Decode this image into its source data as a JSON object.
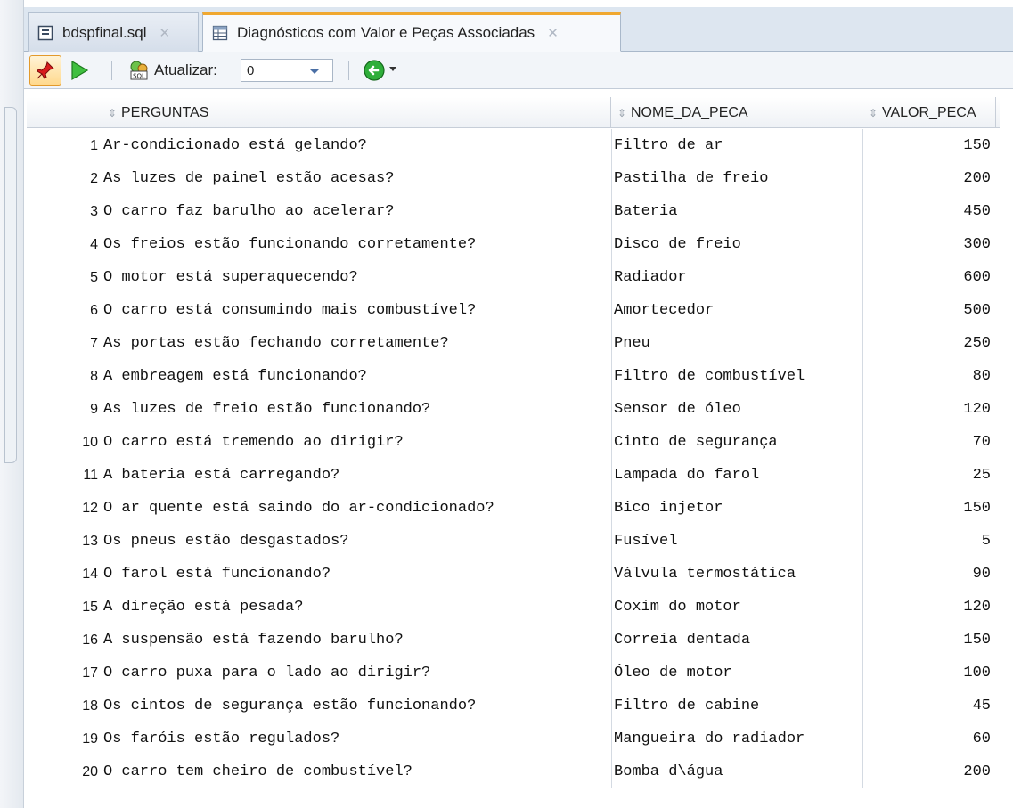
{
  "tabs": [
    {
      "label": "bdspfinal.sql",
      "icon": "sql-file-icon"
    },
    {
      "label": "Diagnósticos com Valor e Peças Associadas",
      "icon": "table-icon"
    }
  ],
  "toolbar": {
    "refresh_label": "Atualizar:",
    "refresh_value": "0"
  },
  "grid": {
    "columns": [
      "PERGUNTAS",
      "NOME_DA_PECA",
      "VALOR_PECA"
    ],
    "rows": [
      {
        "n": "1",
        "pergunta": "Ar-condicionado está gelando?",
        "peca": "Filtro de ar",
        "valor": "150"
      },
      {
        "n": "2",
        "pergunta": "As luzes de painel estão acesas?",
        "peca": "Pastilha de freio",
        "valor": "200"
      },
      {
        "n": "3",
        "pergunta": "O carro faz barulho ao acelerar?",
        "peca": "Bateria",
        "valor": "450"
      },
      {
        "n": "4",
        "pergunta": "Os freios estão funcionando corretamente?",
        "peca": "Disco de freio",
        "valor": "300"
      },
      {
        "n": "5",
        "pergunta": "O motor está superaquecendo?",
        "peca": "Radiador",
        "valor": "600"
      },
      {
        "n": "6",
        "pergunta": "O carro está consumindo mais combustível?",
        "peca": "Amortecedor",
        "valor": "500"
      },
      {
        "n": "7",
        "pergunta": "As portas estão fechando corretamente?",
        "peca": "Pneu",
        "valor": "250"
      },
      {
        "n": "8",
        "pergunta": "A embreagem está funcionando?",
        "peca": "Filtro de combustível",
        "valor": "80"
      },
      {
        "n": "9",
        "pergunta": "As luzes de freio estão funcionando?",
        "peca": "Sensor de óleo",
        "valor": "120"
      },
      {
        "n": "10",
        "pergunta": "O carro está tremendo ao dirigir?",
        "peca": "Cinto de segurança",
        "valor": "70"
      },
      {
        "n": "11",
        "pergunta": "A bateria está carregando?",
        "peca": "Lampada do farol",
        "valor": "25"
      },
      {
        "n": "12",
        "pergunta": "O ar quente está saindo do ar-condicionado?",
        "peca": "Bico injetor",
        "valor": "150"
      },
      {
        "n": "13",
        "pergunta": "Os pneus estão desgastados?",
        "peca": "Fusível",
        "valor": "5"
      },
      {
        "n": "14",
        "pergunta": "O farol está funcionando?",
        "peca": "Válvula termostática",
        "valor": "90"
      },
      {
        "n": "15",
        "pergunta": "A direção está pesada?",
        "peca": "Coxim do motor",
        "valor": "120"
      },
      {
        "n": "16",
        "pergunta": "A suspensão está fazendo barulho?",
        "peca": "Correia dentada",
        "valor": "150"
      },
      {
        "n": "17",
        "pergunta": "O carro puxa para o lado ao dirigir?",
        "peca": "Óleo de motor",
        "valor": "100"
      },
      {
        "n": "18",
        "pergunta": "Os cintos de segurança estão funcionando?",
        "peca": "Filtro de cabine",
        "valor": "45"
      },
      {
        "n": "19",
        "pergunta": "Os faróis estão regulados?",
        "peca": "Mangueira do radiador",
        "valor": "60"
      },
      {
        "n": "20",
        "pergunta": "O carro tem cheiro de combustível?",
        "peca": "Bomba d\\água",
        "valor": "200"
      }
    ]
  }
}
